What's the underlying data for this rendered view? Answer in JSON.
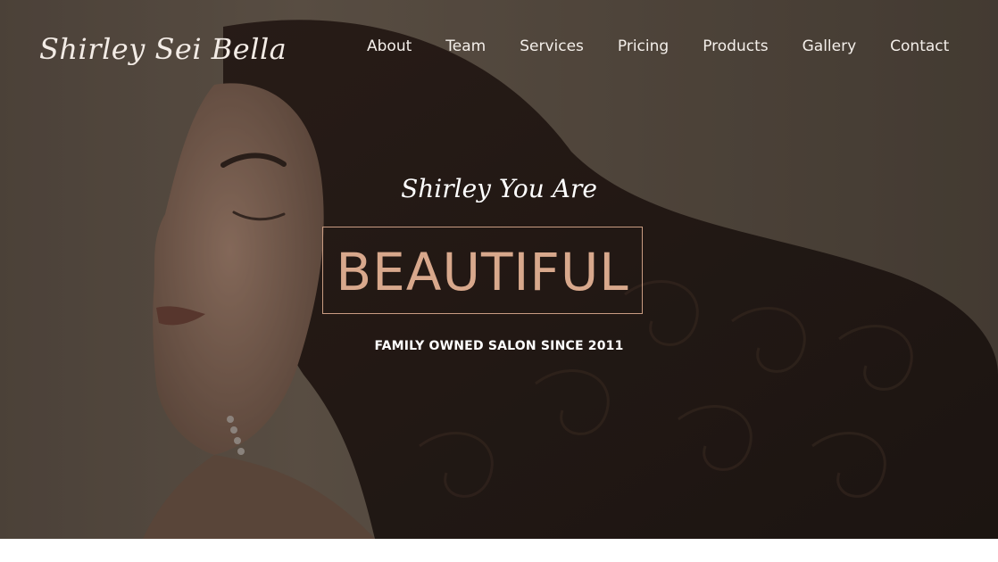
{
  "brand": {
    "logo_text": "Shirley Sei Bella"
  },
  "nav": {
    "items": [
      {
        "label": "About"
      },
      {
        "label": "Team"
      },
      {
        "label": "Services"
      },
      {
        "label": "Pricing"
      },
      {
        "label": "Products"
      },
      {
        "label": "Gallery"
      },
      {
        "label": "Contact"
      }
    ]
  },
  "hero": {
    "tagline": "Shirley You Are",
    "headline": "BEAUTIFUL",
    "subline": "FAMILY OWNED SALON SINCE 2011",
    "image_alt_icon": "woman-portrait-image"
  },
  "colors": {
    "headline_accent": "#d8a88c",
    "box_border": "#c99c82",
    "nav_text": "#f4efea",
    "hero_background": "#5f5448"
  }
}
